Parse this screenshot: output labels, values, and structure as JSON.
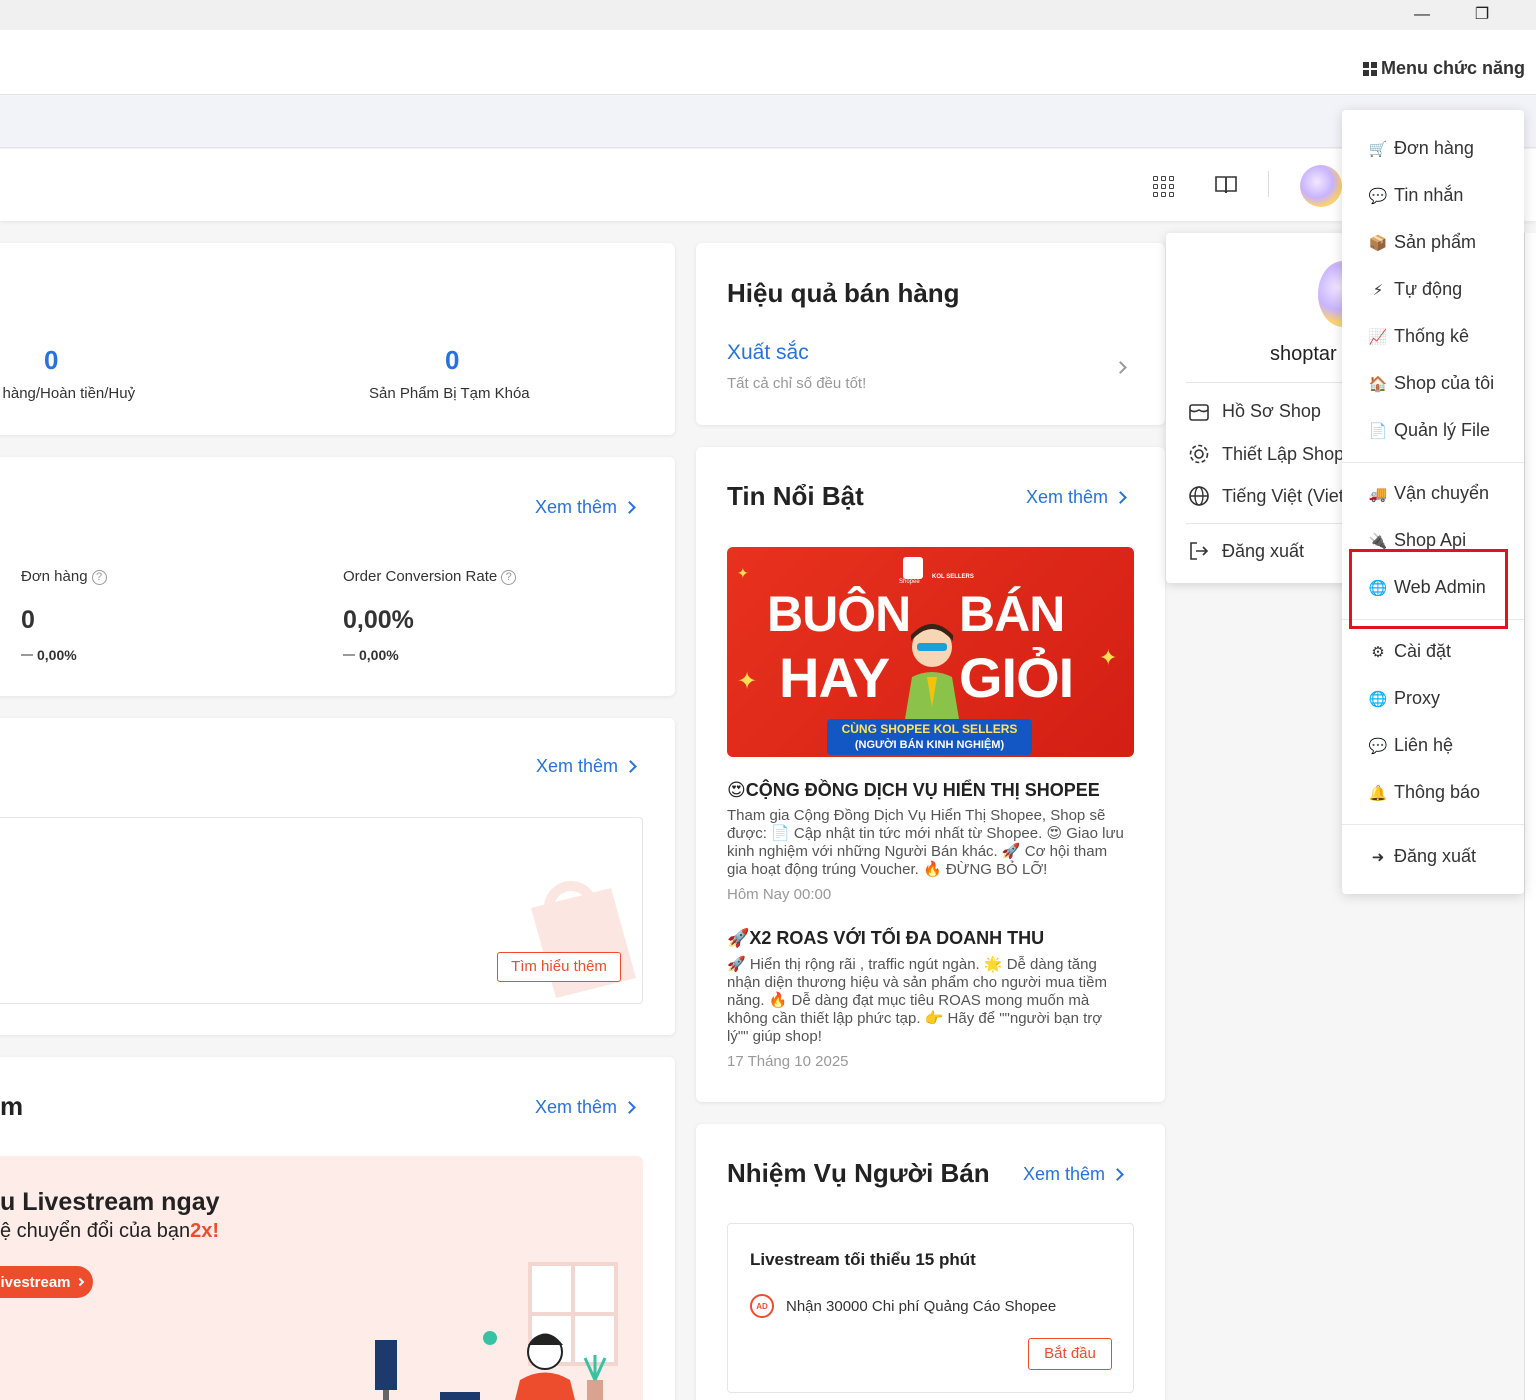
{
  "window": {
    "minimize_glyph": "—",
    "restore_glyph": "❐"
  },
  "topbar": {
    "menu_label": "Menu chức năng"
  },
  "stats_card": {
    "items": [
      {
        "value": "0",
        "label": "ả hàng/Hoàn tiền/Huỷ"
      },
      {
        "value": "0",
        "label": "Sản Phẩm Bị Tạm Khóa"
      }
    ]
  },
  "analytics_card": {
    "see_more": "Xem thêm",
    "metrics": [
      {
        "label": "Đơn hàng",
        "value": "0",
        "change": "0,00%"
      },
      {
        "label": "Order Conversion Rate",
        "value": "0,00%",
        "change": "0,00%"
      }
    ]
  },
  "ads_card": {
    "see_more": "Xem thêm",
    "learn_more": "Tìm hiểu thêm"
  },
  "live_card": {
    "title_tail": "m",
    "see_more": "Xem thêm",
    "promo_line1": "u Livestream ngay",
    "promo_line2_prefix": "ệ chuyển đổi của bạn",
    "promo_line2_highlight": "2x!",
    "cta": "ivestream"
  },
  "performance_card": {
    "title": "Hiệu quả bán hàng",
    "rating": "Xuất sắc",
    "subtitle": "Tất cả chỉ số đều tốt!"
  },
  "news_card": {
    "title": "Tin Nổi Bật",
    "see_more": "Xem thêm",
    "banner": {
      "line1_left": "BUÔN",
      "line1_right": "BÁN",
      "line2_left": "HAY",
      "line2_right": "GIỎI",
      "caption1": "CÙNG SHOPEE KOL SELLERS",
      "caption2": "(NGƯỜI BÁN KINH NGHIỆM)",
      "brand1": "Shopee",
      "brand2": "KOL SELLERS"
    },
    "items": [
      {
        "title": "😍CỘNG ĐỒNG DỊCH VỤ HIỂN THỊ SHOPEE",
        "body": "Tham gia Cộng Đồng Dịch Vụ Hiển Thị Shopee, Shop sẽ được: 📄 Cập nhật tin tức mới nhất từ Shopee. 😍 Giao lưu kinh nghiệm với những Người Bán khác. 🚀 Cơ hội tham gia hoạt động trúng Voucher. 🔥 ĐỪNG BỎ LỠ!",
        "time": "Hôm Nay 00:00"
      },
      {
        "title": "🚀X2 ROAS VỚI TỐI ĐA DOANH THU",
        "body": "🚀 Hiển thị rộng rãi , traffic ngút ngàn. 🌟 Dễ dàng tăng nhận diện thương hiệu và sản phẩm cho người mua tiềm năng. 🔥 Dễ dàng đạt mục tiêu ROAS mong muốn mà không cần thiết lập phức tạp. 👉 Hãy để \"\"người bạn trợ lý\"\" giúp shop!",
        "time": "17 Tháng 10 2025"
      }
    ]
  },
  "mission_card": {
    "title": "Nhiệm Vụ Người Bán",
    "see_more": "Xem thêm",
    "task_title": "Livestream tối thiểu 15 phút",
    "ad_badge": "AD",
    "reward": "Nhận 30000 Chi phí Quảng Cáo Shopee",
    "start": "Bắt đầu"
  },
  "user_dropdown": {
    "shop_name": "shoptar",
    "items": [
      {
        "icon": "shop-profile-icon",
        "label": "Hồ Sơ Shop"
      },
      {
        "icon": "settings-gear-icon",
        "label": "Thiết Lập Shop"
      },
      {
        "icon": "globe-icon",
        "label": "Tiếng Việt (Viet"
      },
      {
        "icon": "logout-icon",
        "label": "Đăng xuất"
      }
    ]
  },
  "side_menu": {
    "items": [
      {
        "icon": "cart-icon",
        "glyph": "🛒",
        "label": "Đơn hàng"
      },
      {
        "icon": "chat-icon",
        "glyph": "💬",
        "label": "Tin nhắn"
      },
      {
        "icon": "boxes-icon",
        "glyph": "📦",
        "label": "Sản phẩm"
      },
      {
        "icon": "bolt-icon",
        "glyph": "⚡",
        "label": "Tự động"
      },
      {
        "icon": "area-chart-icon",
        "glyph": "📈",
        "label": "Thống kê"
      },
      {
        "icon": "home-icon",
        "glyph": "🏠",
        "label": "Shop của tôi"
      },
      {
        "icon": "file-icon",
        "glyph": "📄",
        "label": "Quản lý File"
      },
      {
        "icon": "truck-icon",
        "glyph": "🚚",
        "label": "Vận chuyển"
      },
      {
        "icon": "plug-icon",
        "glyph": "🔌",
        "label": "Shop Api"
      },
      {
        "icon": "globe-icon",
        "glyph": "🌐",
        "label": "Web Admin"
      },
      {
        "icon": "gear-icon",
        "glyph": "⚙",
        "label": "Cài đặt"
      },
      {
        "icon": "globe-icon",
        "glyph": "🌐",
        "label": "Proxy"
      },
      {
        "icon": "speech-bubble-icon",
        "glyph": "💬",
        "label": "Liên hệ"
      },
      {
        "icon": "bell-icon",
        "glyph": "🔔",
        "label": "Thông báo"
      },
      {
        "icon": "sign-out-icon",
        "glyph": "➜",
        "label": "Đăng xuất"
      }
    ]
  },
  "colors": {
    "accent_blue": "#2673dd",
    "brand_orange": "#ee4d2d",
    "highlight_red": "#e0141e"
  }
}
